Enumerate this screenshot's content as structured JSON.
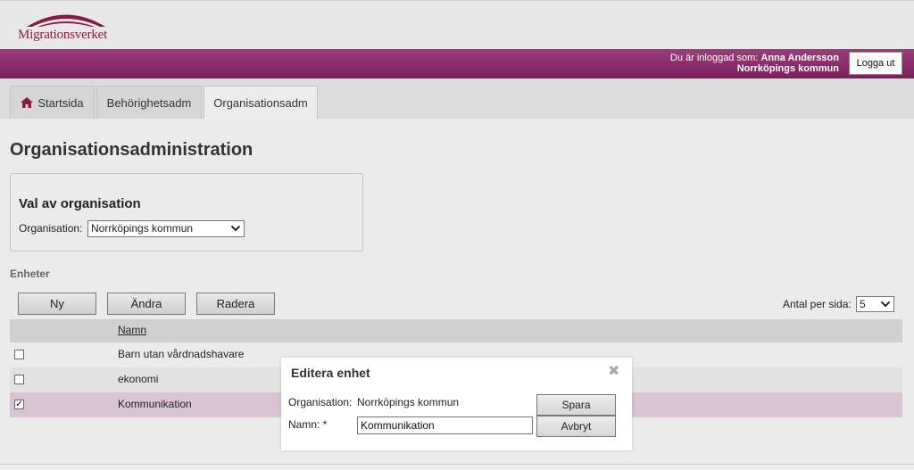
{
  "brand": {
    "name": "Migrationsverket",
    "color": "#8b1a3c"
  },
  "user": {
    "label": "Du är inloggad som:",
    "name": "Anna Andersson",
    "org": "Norrköpings kommun",
    "logout_label": "Logga ut"
  },
  "tabs": [
    {
      "label": "Startsida",
      "icon": "home-icon"
    },
    {
      "label": "Behörighetsadm"
    },
    {
      "label": "Organisationsadm",
      "active": true
    }
  ],
  "page": {
    "title": "Organisationsadministration",
    "org_box": {
      "title": "Val av organisation",
      "label": "Organisation:",
      "selected": "Norrköpings kommun"
    },
    "units": {
      "heading": "Enheter",
      "buttons": {
        "new": "Ny",
        "edit": "Ändra",
        "delete": "Radera"
      },
      "per_page_label": "Antal per sida:",
      "per_page_value": "5",
      "column_name": "Namn",
      "rows": [
        {
          "name": "Barn utan vårdnadshavare",
          "checked": false
        },
        {
          "name": "ekonomi",
          "checked": false
        },
        {
          "name": "Kommunikation",
          "checked": true
        }
      ]
    }
  },
  "dialog": {
    "title": "Editera enhet",
    "org_label": "Organisation:",
    "org_value": "Norrköpings kommun",
    "name_label": "Namn: *",
    "name_value": "Kommunikation",
    "save_label": "Spara",
    "cancel_label": "Avbryt"
  },
  "colors": {
    "accent": "#8b2a6b",
    "selected_row": "#d9c4d2"
  }
}
